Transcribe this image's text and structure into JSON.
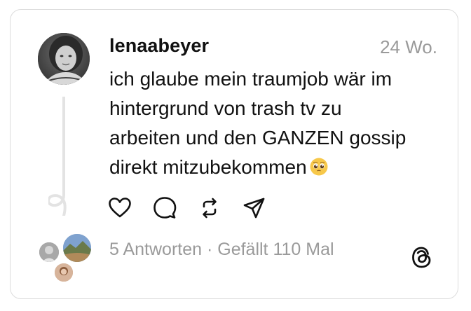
{
  "post": {
    "username": "lenaabeyer",
    "time": "24 Wo.",
    "text_line1": "ich glaube mein traumjob wär im",
    "text_line2": "hintergrund von trash tv zu",
    "text_line3": "arbeiten und den GANZEN gossip",
    "text_line4": "direkt mitzubekommen",
    "emoji": "pleading-face-emoji"
  },
  "actions": {
    "like_icon": "heart-icon",
    "reply_icon": "comment-icon",
    "repost_icon": "repost-icon",
    "share_icon": "send-icon"
  },
  "stats": {
    "replies": "5 Antworten",
    "separator": " · ",
    "likes": "Gefällt 110 Mal"
  },
  "branding": {
    "logo_icon": "threads-logo-icon"
  },
  "colors": {
    "text": "#111111",
    "muted": "#9a9a9a",
    "border": "#dcdcdc",
    "thread_line": "#e3e3e3"
  }
}
